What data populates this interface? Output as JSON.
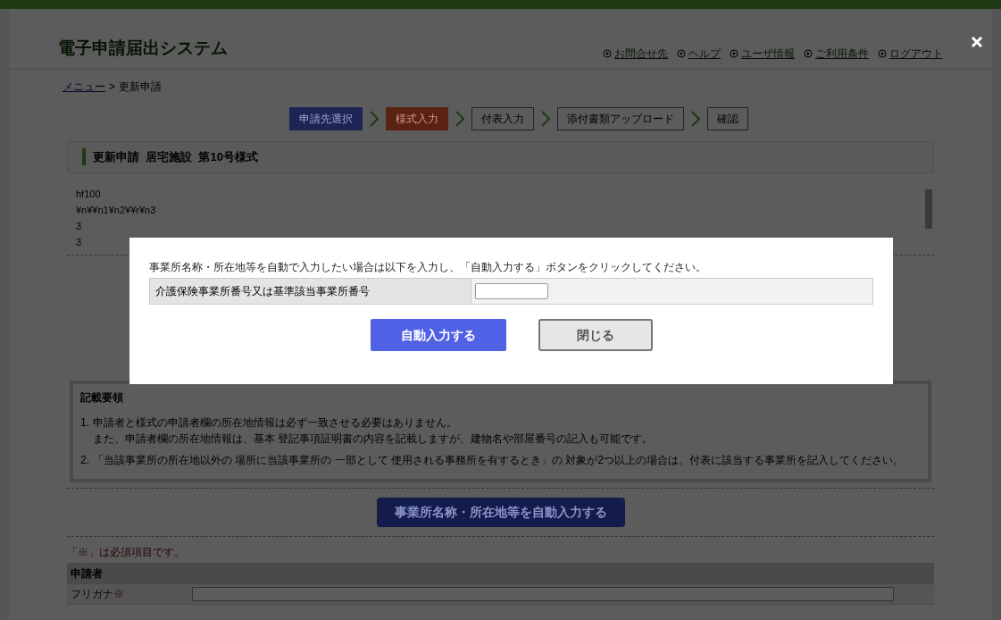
{
  "header": {
    "title": "電子申請届出システム",
    "links": [
      "お問合せ先",
      "ヘルプ",
      "ユーザ情報",
      "ご利用条件",
      "ログアウト"
    ]
  },
  "breadcrumb": {
    "link": "メニュー",
    "separator": ">",
    "current": "更新申請"
  },
  "steps": [
    {
      "label": "申請先選択",
      "done": true,
      "selected": false
    },
    {
      "label": "様式入力",
      "done": false,
      "selected": true
    },
    {
      "label": "付表入力",
      "done": false,
      "selected": false
    },
    {
      "label": "添付書類アップロード",
      "done": false,
      "selected": false
    },
    {
      "label": "確認",
      "done": false,
      "selected": false
    }
  ],
  "form_title": "更新申請  居宅施設  第10号様式",
  "text_area": [
    "hf100",
    "¥n¥¥n1¥n2¥¥r¥n3",
    "3",
    "3"
  ],
  "notes": {
    "heading": "記載要領",
    "items": [
      {
        "number": "1.",
        "lines": [
          "申請者と様式の申請者欄の所在地情報は必ず一致させる必要はありません。",
          "また、申請者欄の所在地情報は、基本 登記事項証明書の内容を記載しますが、建物名や部屋番号の記入も可能です。"
        ]
      },
      {
        "number": "2.",
        "lines": [
          "「当該事業所の所在地以外の 場所に当該事業所の 一部として 使用される事務所を有するとき」の 対象が2つ以上の場合は、付表に該当する事業所を記入してください。"
        ]
      }
    ]
  },
  "auto_fill_button": "事業所名称・所在地等を自動入力する",
  "required_note": "「※」は必須項目です。",
  "applicant": {
    "heading": "申請者",
    "fields": [
      {
        "label": "フリガナ",
        "required_mark": "※"
      }
    ]
  },
  "modal": {
    "message": "事業所名称・所在地等を自動で入力したい場合は以下を入力し、「自動入力する」ボタンをクリックしてください。",
    "field_label": "介護保険事業所番号又は基準該当事業所番号",
    "primary_button": "自動入力する",
    "secondary_button": "閉じる"
  }
}
